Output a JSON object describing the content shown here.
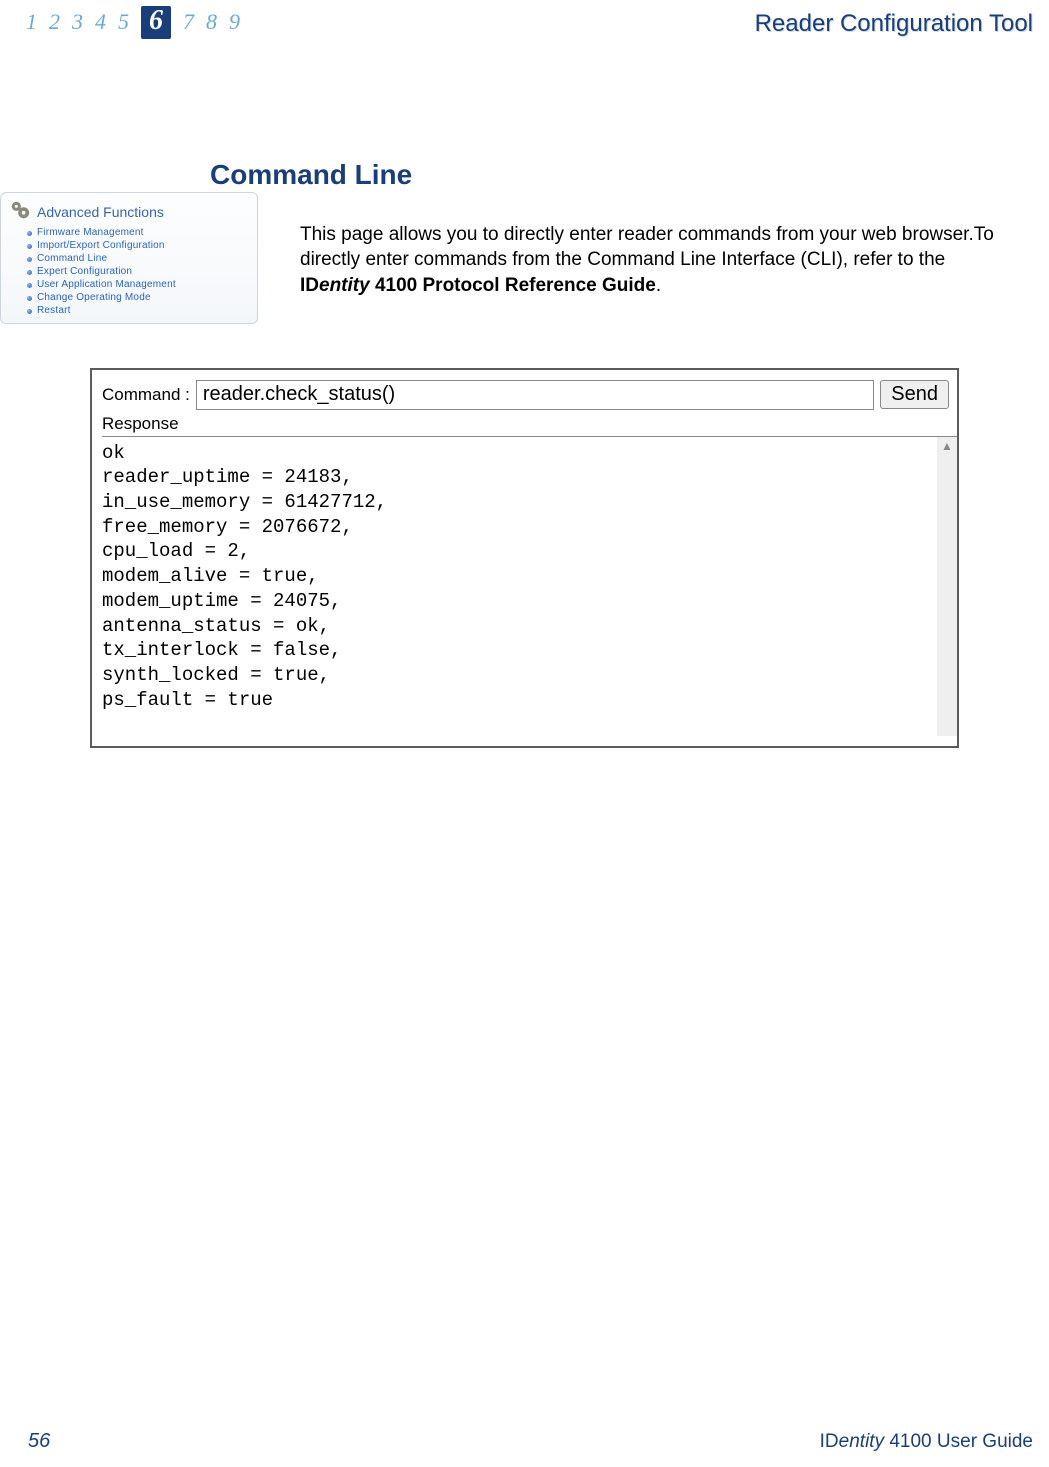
{
  "chapters": [
    "1",
    "2",
    "3",
    "4",
    "5",
    "6",
    "7",
    "8",
    "9"
  ],
  "active_chapter_index": 5,
  "header_title": "Reader Configuration Tool",
  "section_heading": "Command Line",
  "intro": {
    "seg1": "This page allows you to directly enter reader commands from your web browser.To directly enter commands from the Command Line Interface (CLI), refer to the ",
    "seg2_prefix": "ID",
    "seg2_italic": "entity",
    "seg2_suffix": " 4100 Protocol Reference Guide",
    "seg3": "."
  },
  "sidebar": {
    "title": "Advanced Functions",
    "items": [
      "Firmware Management",
      "Import/Export Configuration",
      "Command Line",
      "Expert Configuration",
      "User Application Management",
      "Change Operating Mode",
      "Restart"
    ]
  },
  "cli": {
    "command_label": "Command :",
    "command_value": "reader.check_status()",
    "send_label": "Send",
    "response_label": "Response",
    "response_text": "ok\nreader_uptime = 24183,\nin_use_memory = 61427712,\nfree_memory = 2076672,\ncpu_load = 2,\nmodem_alive = true,\nmodem_uptime = 24075,\nantenna_status = ok,\ntx_interlock = false,\nsynth_locked = true,\nps_fault = true"
  },
  "footer": {
    "page": "56",
    "doc_prefix": "ID",
    "doc_italic": "entity",
    "doc_suffix": " 4100 User Guide"
  }
}
